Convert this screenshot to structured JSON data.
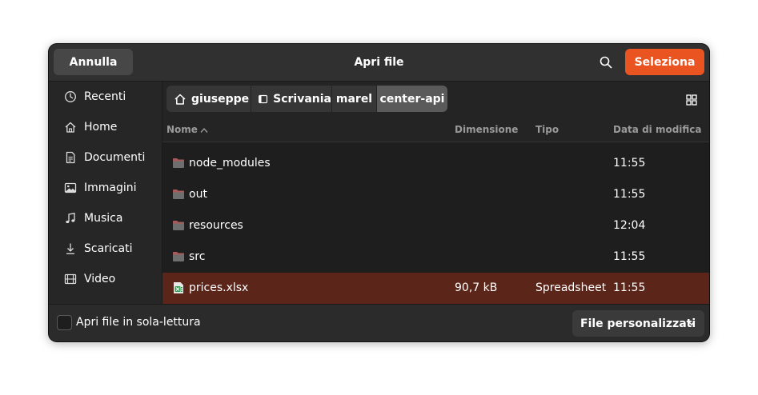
{
  "header": {
    "title": "Apri file",
    "cancel_label": "Annulla",
    "select_label": "Seleziona",
    "search_icon": "search-icon"
  },
  "sidebar": {
    "items": [
      {
        "label": "Recenti",
        "icon": "clock-icon"
      },
      {
        "label": "Home",
        "icon": "home-icon"
      },
      {
        "label": "Documenti",
        "icon": "document-icon"
      },
      {
        "label": "Immagini",
        "icon": "image-icon"
      },
      {
        "label": "Musica",
        "icon": "music-icon"
      },
      {
        "label": "Scaricati",
        "icon": "download-icon"
      },
      {
        "label": "Video",
        "icon": "video-icon"
      }
    ]
  },
  "pathbar": {
    "crumbs": [
      {
        "label": "giuseppe",
        "icon": "home-icon"
      },
      {
        "label": "Scrivania",
        "icon": "desktop-icon"
      },
      {
        "label": "marel"
      },
      {
        "label": "center-api",
        "active": true
      }
    ],
    "view_icon": "grid-view-icon"
  },
  "columns": {
    "name": "Nome",
    "size": "Dimensione",
    "type": "Tipo",
    "modified": "Data di modifica"
  },
  "files": [
    {
      "name": "node_modules",
      "size": "",
      "type": "",
      "modified": "11:55",
      "icon": "folder-icon"
    },
    {
      "name": "out",
      "size": "",
      "type": "",
      "modified": "11:55",
      "icon": "folder-icon"
    },
    {
      "name": "resources",
      "size": "",
      "type": "",
      "modified": "12:04",
      "icon": "folder-icon"
    },
    {
      "name": "src",
      "size": "",
      "type": "",
      "modified": "11:55",
      "icon": "folder-icon"
    },
    {
      "name": "prices.xlsx",
      "size": "90,7 kB",
      "type": "Spreadsheet",
      "modified": "11:55",
      "icon": "spreadsheet-icon",
      "selected": true
    }
  ],
  "footer": {
    "readonly_label": "Apri file in sola-lettura",
    "readonly_checked": false,
    "filter_label": "File personalizzati"
  },
  "colors": {
    "accent": "#e95420",
    "selected_row": "#5b2619",
    "folder": "#a85a5a"
  }
}
